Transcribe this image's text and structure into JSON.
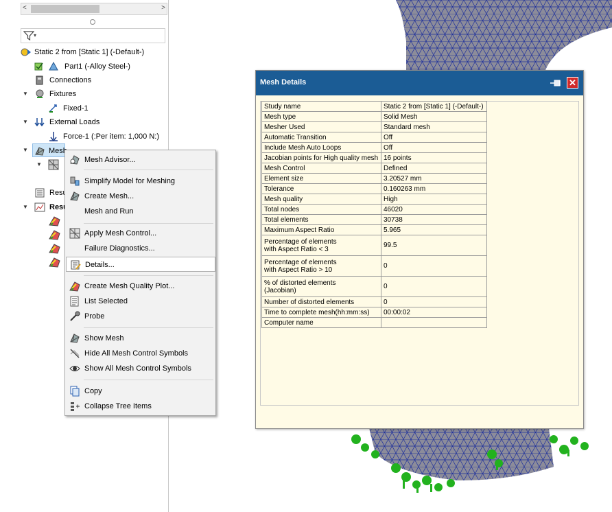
{
  "tree": {
    "filter_glyph": "▾",
    "scroll_left": "<",
    "scroll_right": ">",
    "nodes": [
      {
        "label": "Static 2 from [Static 1] (-Default-)"
      },
      {
        "label": "Part1 (-Alloy Steel-)"
      },
      {
        "label": "Connections"
      },
      {
        "label": "Fixtures"
      },
      {
        "label": "Fixed-1"
      },
      {
        "label": "External Loads"
      },
      {
        "label": "Force-1 (:Per item: 1,000 N:)"
      },
      {
        "label": "Mesh"
      },
      {
        "label": "Resu"
      },
      {
        "label": "Resu"
      }
    ]
  },
  "context_menu": {
    "items": [
      {
        "label": "Mesh Advisor...",
        "icon": "mesh-advisor-icon"
      },
      {
        "label": "Simplify Model for Meshing",
        "icon": "simplify-icon"
      },
      {
        "label": "Create Mesh...",
        "icon": "create-mesh-icon"
      },
      {
        "label": "Mesh and Run",
        "icon": ""
      },
      {
        "label": "Apply Mesh Control...",
        "icon": "mesh-control-icon"
      },
      {
        "label": "Failure Diagnostics...",
        "icon": ""
      },
      {
        "label": "Details...",
        "icon": "details-icon"
      },
      {
        "label": "Create Mesh Quality Plot...",
        "icon": "quality-plot-icon"
      },
      {
        "label": "List Selected",
        "icon": "list-icon"
      },
      {
        "label": "Probe",
        "icon": "probe-icon"
      },
      {
        "label": "Show Mesh",
        "icon": "show-mesh-icon"
      },
      {
        "label": "Hide All Mesh Control Symbols",
        "icon": "hide-icon"
      },
      {
        "label": "Show All Mesh Control Symbols",
        "icon": "eye-icon"
      },
      {
        "label": "Copy",
        "icon": "copy-icon"
      },
      {
        "label": "Collapse Tree Items",
        "icon": "collapse-icon"
      }
    ]
  },
  "dialog": {
    "title": "Mesh Details",
    "close_glyph": "✕",
    "rows": [
      {
        "key": "Study name",
        "value": "Static 2 from [Static 1] (-Default-)"
      },
      {
        "key": "Mesh type",
        "value": "Solid Mesh"
      },
      {
        "key": "Mesher Used",
        "value": "Standard mesh"
      },
      {
        "key": "Automatic Transition",
        "value": "Off"
      },
      {
        "key": "Include Mesh Auto Loops",
        "value": "Off"
      },
      {
        "key": "Jacobian points for High quality mesh",
        "value": "16 points"
      },
      {
        "key": "Mesh Control",
        "value": "Defined"
      },
      {
        "key": "Element size",
        "value": "3.20527 mm"
      },
      {
        "key": "Tolerance",
        "value": "0.160263 mm"
      },
      {
        "key": "Mesh quality",
        "value": "High"
      },
      {
        "key": "Total nodes",
        "value": "46020"
      },
      {
        "key": "Total elements",
        "value": "30738"
      },
      {
        "key": "Maximum Aspect Ratio",
        "value": "5.965"
      },
      {
        "key": "Percentage of elements\nwith Aspect Ratio < 3",
        "value": "99.5"
      },
      {
        "key": "Percentage of elements\nwith Aspect Ratio > 10",
        "value": "0"
      },
      {
        "key": "% of distorted elements\n(Jacobian)",
        "value": "0"
      },
      {
        "key": "Number of distorted elements",
        "value": "0"
      },
      {
        "key": "Time to complete mesh(hh:mm:ss)",
        "value": "00:00:02"
      },
      {
        "key": "Computer name",
        "value": ""
      }
    ]
  },
  "colors": {
    "dialog_title_bg": "#1b5c95",
    "dialog_body_bg": "#fffbe6",
    "mesh_gray": "#8c8c9a",
    "mesh_lines": "#1d2f9c",
    "fixture_green": "#22b21e"
  }
}
